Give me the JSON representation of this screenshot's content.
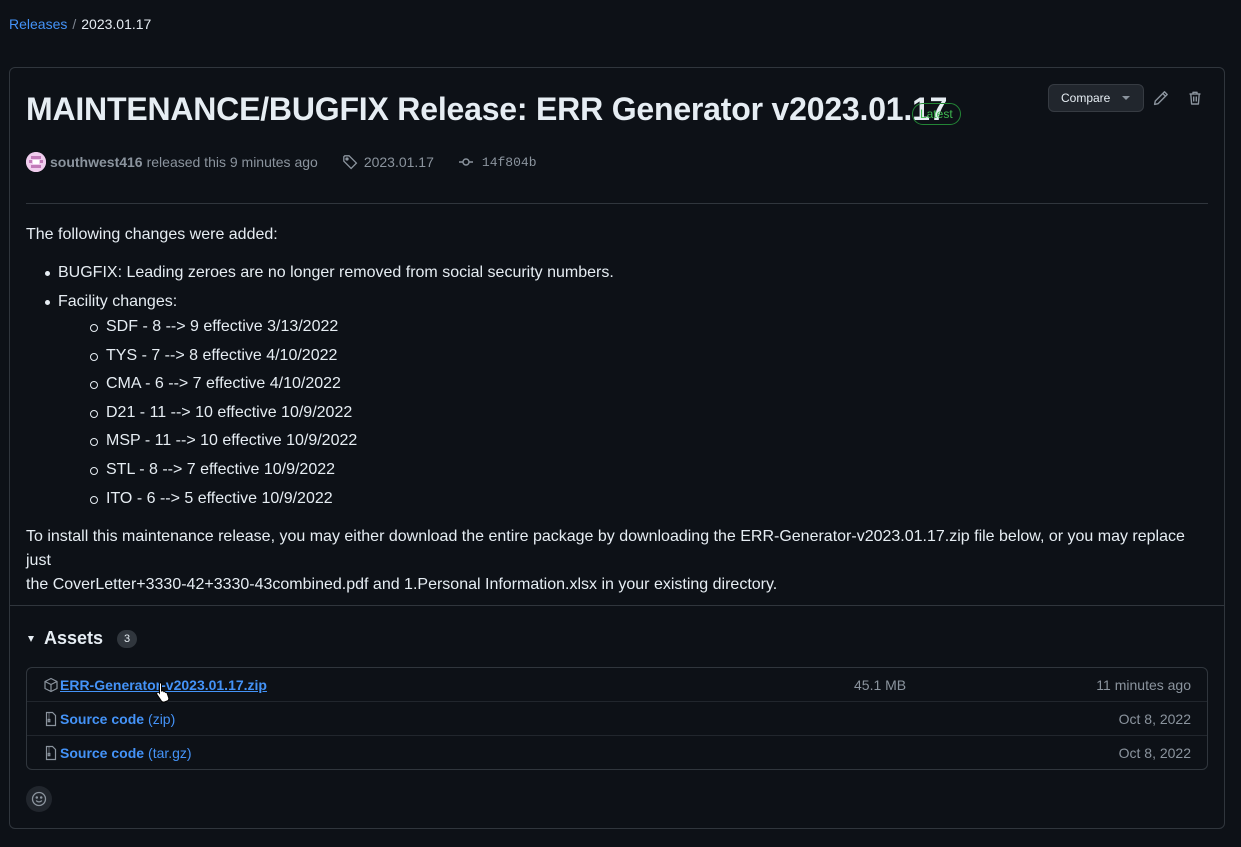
{
  "breadcrumb": {
    "root": "Releases",
    "separator": "/",
    "current": "2023.01.17"
  },
  "release": {
    "title": "MAINTENANCE/BUGFIX Release: ERR Generator v2023.01.17",
    "badge": "Latest",
    "author": "southwest416",
    "released_text": "released this 9 minutes ago",
    "tag": "2023.01.17",
    "commit": "14f804b"
  },
  "actions": {
    "compare_label": "Compare",
    "edit_icon": "pencil-icon",
    "delete_icon": "trash-icon"
  },
  "notes": {
    "intro": "The following changes were added:",
    "bugfix": "BUGFIX: Leading zeroes are no longer removed from social security numbers.",
    "facility_heading": "Facility changes:",
    "facility_changes": [
      "SDF - 8 --> 9 effective 3/13/2022",
      "TYS - 7 --> 8 effective 4/10/2022",
      "CMA - 6 --> 7 effective 4/10/2022",
      "D21 - 11 --> 10 effective 10/9/2022",
      "MSP - 11 --> 10 effective 10/9/2022",
      "STL - 8 --> 7 effective 10/9/2022",
      "ITO - 6 --> 5 effective 10/9/2022"
    ],
    "install_line1": "To install this maintenance release, you may either download the entire package by downloading the ERR-Generator-v2023.01.17.zip file below, or you may replace just",
    "install_line2": "the CoverLetter+3330-42+3330-43combined.pdf and 1.Personal Information.xlsx in your existing directory."
  },
  "assets": {
    "heading": "Assets",
    "count": "3",
    "items": [
      {
        "name": "ERR-Generator-v2023.01.17.zip",
        "ext": "",
        "size": "45.1 MB",
        "date": "11 minutes ago",
        "icon": "package-icon"
      },
      {
        "name": "Source code",
        "ext": "(zip)",
        "size": "",
        "date": "Oct 8, 2022",
        "icon": "file-zip-icon"
      },
      {
        "name": "Source code",
        "ext": "(tar.gz)",
        "size": "",
        "date": "Oct 8, 2022",
        "icon": "file-zip-icon"
      }
    ]
  },
  "colors": {
    "background": "#0d1117",
    "link": "#4493f8",
    "badge_green": "#3fb950",
    "border": "#30363d",
    "muted": "#8b949e"
  }
}
